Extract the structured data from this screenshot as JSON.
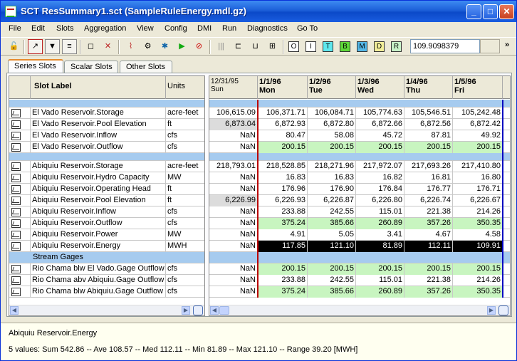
{
  "window": {
    "title": "SCT ResSummary1.sct (SampleRuleEnergy.mdl.gz)",
    "min_glyph": "_",
    "max_glyph": "□",
    "close_glyph": "✕"
  },
  "menu": [
    "File",
    "Edit",
    "Slots",
    "Aggregation",
    "View",
    "Config",
    "DMI",
    "Run",
    "Diagnostics",
    "Go To"
  ],
  "toolbar": {
    "color_buttons": [
      {
        "label": "O",
        "color": "#ffffff"
      },
      {
        "label": "I",
        "color": "#ffffff"
      },
      {
        "label": "T",
        "color": "#5fe8ee"
      },
      {
        "label": "B",
        "color": "#5fd83a"
      },
      {
        "label": "M",
        "color": "#54b8e8"
      },
      {
        "label": "D",
        "color": "#f2ee9a"
      },
      {
        "label": "R",
        "color": "#c8f2c8"
      }
    ],
    "value_field": "109.9098379",
    "more": "»"
  },
  "tabs": [
    "Series Slots",
    "Scalar Slots",
    "Other Slots"
  ],
  "slot_table": {
    "headers": {
      "label": "Slot Label",
      "units": "Units"
    }
  },
  "dates": [
    {
      "date": "12/31/95",
      "day": "Sun"
    },
    {
      "date": "1/1/96",
      "day": "Mon"
    },
    {
      "date": "1/2/96",
      "day": "Tue"
    },
    {
      "date": "1/3/96",
      "day": "Wed"
    },
    {
      "date": "1/4/96",
      "day": "Thu"
    },
    {
      "date": "1/5/96",
      "day": "Fri"
    }
  ],
  "rows": [
    {
      "type": "sep"
    },
    {
      "label": "El Vado Reservoir.Storage",
      "units": "acre-feet",
      "values": [
        "106,615.09",
        "106,371.71",
        "106,084.71",
        "105,774.63",
        "105,546.51",
        "105,242.48"
      ],
      "style": "normal"
    },
    {
      "label": "El Vado Reservoir.Pool Elevation",
      "units": "ft",
      "values": [
        "6,873.04",
        "6,872.93",
        "6,872.80",
        "6,872.66",
        "6,872.56",
        "6,872.42"
      ],
      "style": "normal",
      "first_gray": true
    },
    {
      "label": "El Vado Reservoir.Inflow",
      "units": "cfs",
      "values": [
        "NaN",
        "80.47",
        "58.08",
        "45.72",
        "87.81",
        "49.92"
      ],
      "style": "normal"
    },
    {
      "label": "El Vado Reservoir.Outflow",
      "units": "cfs",
      "values": [
        "NaN",
        "200.15",
        "200.15",
        "200.15",
        "200.15",
        "200.15"
      ],
      "style": "green"
    },
    {
      "type": "sep"
    },
    {
      "label": "Abiquiu Reservoir.Storage",
      "units": "acre-feet",
      "values": [
        "218,793.01",
        "218,528.85",
        "218,271.96",
        "217,972.07",
        "217,693.26",
        "217,410.80"
      ],
      "style": "normal"
    },
    {
      "label": "Abiquiu Reservoir.Hydro Capacity",
      "units": "MW",
      "values": [
        "NaN",
        "16.83",
        "16.83",
        "16.82",
        "16.81",
        "16.80"
      ],
      "style": "normal"
    },
    {
      "label": "Abiquiu Reservoir.Operating Head",
      "units": "ft",
      "values": [
        "NaN",
        "176.96",
        "176.90",
        "176.84",
        "176.77",
        "176.71"
      ],
      "style": "normal"
    },
    {
      "label": "Abiquiu Reservoir.Pool Elevation",
      "units": "ft",
      "values": [
        "6,226.99",
        "6,226.93",
        "6,226.87",
        "6,226.80",
        "6,226.74",
        "6,226.67"
      ],
      "style": "normal",
      "first_gray": true
    },
    {
      "label": "Abiquiu Reservoir.Inflow",
      "units": "cfs",
      "values": [
        "NaN",
        "233.88",
        "242.55",
        "115.01",
        "221.38",
        "214.26"
      ],
      "style": "normal"
    },
    {
      "label": "Abiquiu Reservoir.Outflow",
      "units": "cfs",
      "values": [
        "NaN",
        "375.24",
        "385.66",
        "260.89",
        "357.26",
        "350.35"
      ],
      "style": "green"
    },
    {
      "label": "Abiquiu Reservoir.Power",
      "units": "MW",
      "values": [
        "NaN",
        "4.91",
        "5.05",
        "3.41",
        "4.67",
        "4.58"
      ],
      "style": "normal"
    },
    {
      "label": "Abiquiu Reservoir.Energy",
      "units": "MWH",
      "values": [
        "NaN",
        "117.85",
        "121.10",
        "81.89",
        "112.11",
        "109.91"
      ],
      "style": "selected"
    },
    {
      "type": "group",
      "label": "Stream Gages"
    },
    {
      "label": "Rio Chama blw El Vado.Gage Outflow",
      "units": "cfs",
      "values": [
        "NaN",
        "200.15",
        "200.15",
        "200.15",
        "200.15",
        "200.15"
      ],
      "style": "green"
    },
    {
      "label": "Rio Chama abv Abiquiu.Gage Outflow",
      "units": "cfs",
      "values": [
        "NaN",
        "233.88",
        "242.55",
        "115.01",
        "221.38",
        "214.26"
      ],
      "style": "normal"
    },
    {
      "label": "Rio Chama blw Abiquiu.Gage Outflow",
      "units": "cfs",
      "values": [
        "NaN",
        "375.24",
        "385.66",
        "260.89",
        "357.26",
        "350.35"
      ],
      "style": "green"
    }
  ],
  "status": {
    "slot": "Abiquiu Reservoir.Energy",
    "summary": "5 values:  Sum 542.86 -- Ave 108.57 -- Med 112.11 -- Min 81.89 -- Max 121.10 -- Range 39.20 [MWH]"
  }
}
